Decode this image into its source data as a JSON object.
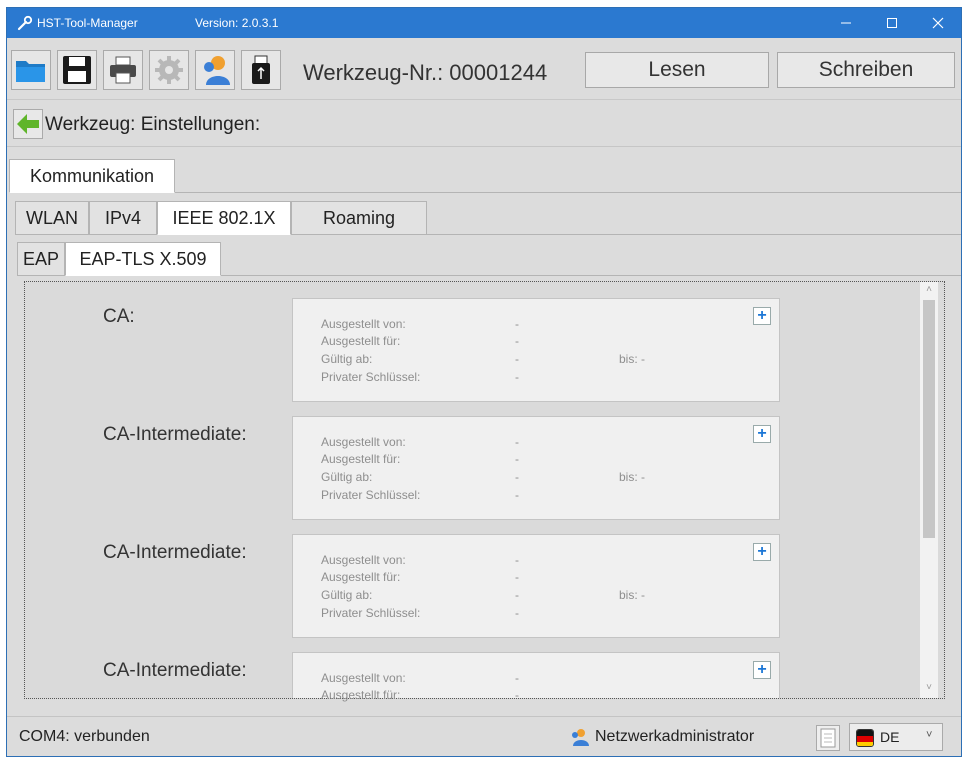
{
  "window": {
    "title": "HST-Tool-Manager",
    "version": "Version: 2.0.3.1",
    "controls": {
      "minimize": "—",
      "maximize": "☐",
      "close": "✕"
    }
  },
  "toolbar": {
    "icons": [
      "folder-open-icon",
      "save-icon",
      "print-icon",
      "settings-icon",
      "user-icon",
      "usb-icon"
    ],
    "werkzeug_nr": "Werkzeug-Nr.: 00001244",
    "lesen_label": "Lesen",
    "schreiben_label": "Schreiben"
  },
  "nav": {
    "title": "Werkzeug: Einstellungen:"
  },
  "tabs": {
    "level1": [
      "Kommunikation"
    ],
    "level2": [
      "WLAN",
      "IPv4",
      "IEEE 802.1X",
      "Roaming"
    ],
    "level3": [
      "EAP",
      "EAP-TLS X.509"
    ]
  },
  "cert_fields": {
    "issued_by": "Ausgestellt von:",
    "issued_to": "Ausgestellt für:",
    "valid_from": "Gültig ab:",
    "private_key": "Privater Schlüssel:",
    "until": "bis:",
    "dash": "-"
  },
  "sections": [
    {
      "label": "CA:"
    },
    {
      "label": "CA-Intermediate:"
    },
    {
      "label": "CA-Intermediate:"
    },
    {
      "label": "CA-Intermediate:"
    }
  ],
  "statusbar": {
    "connection": "COM4: verbunden",
    "user": "Netzwerkadministrator",
    "language": "DE"
  },
  "colors": {
    "titlebar": "#2b79d0",
    "accent_plus": "#1b76d6"
  }
}
